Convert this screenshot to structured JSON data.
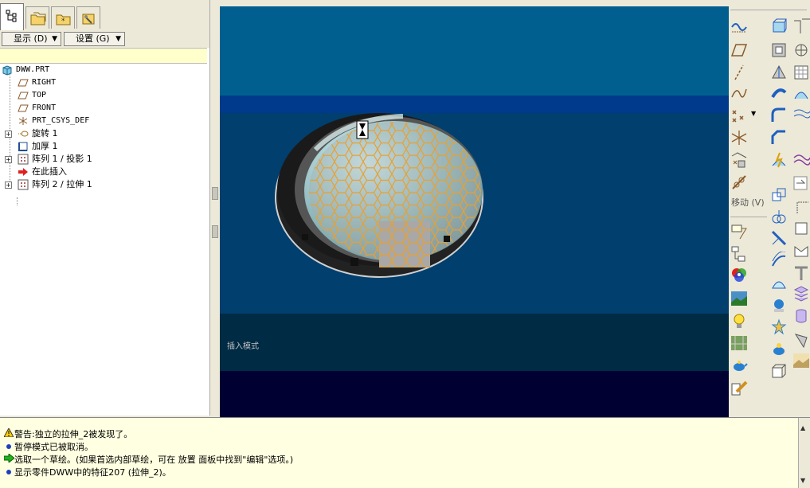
{
  "toolbar": {
    "display_label": "显示 (D)",
    "settings_label": "设置 (G)"
  },
  "tree": [
    {
      "label": "DWW.PRT",
      "icon": "part-icon",
      "expand": ""
    },
    {
      "label": "RIGHT",
      "icon": "datum-plane-icon",
      "expand": ""
    },
    {
      "label": "TOP",
      "icon": "datum-plane-icon",
      "expand": ""
    },
    {
      "label": "FRONT",
      "icon": "datum-plane-icon",
      "expand": ""
    },
    {
      "label": "PRT_CSYS_DEF",
      "icon": "coordinate-system-icon",
      "expand": ""
    },
    {
      "label": "旋转 1",
      "icon": "revolve-icon",
      "expand": "+"
    },
    {
      "label": "加厚 1",
      "icon": "thicken-icon",
      "expand": ""
    },
    {
      "label": "阵列 1 / 投影 1",
      "icon": "pattern-icon",
      "expand": "+"
    },
    {
      "label": "在此插入",
      "icon": "insert-here-arrow-icon",
      "expand": ""
    },
    {
      "label": "阵列 2 / 拉伸 1",
      "icon": "pattern-icon",
      "expand": "+"
    }
  ],
  "viewport": {
    "status_text": "插入模式"
  },
  "right_toolbar": {
    "move_label": "移动 (V)"
  },
  "messages": [
    {
      "icon": "warning-icon",
      "text": "警告:独立的拉伸_2被发现了。"
    },
    {
      "icon": "info-bullet-icon",
      "text": "暂停模式已被取消。"
    },
    {
      "icon": "prompt-arrow-icon",
      "text": "选取一个草绘。(如果首选内部草绘，可在 放置 面板中找到\"编辑\"选项。)"
    },
    {
      "icon": "info-bullet-icon",
      "text": "显示零件DWW中的特征207 (拉伸_2)。"
    }
  ],
  "colors": {
    "viewport_top": "#005f8f",
    "viewport_band": "#003a8c",
    "viewport_mid": "#003f6e",
    "viewport_dark": "#002b44",
    "viewport_bottom": "#000033",
    "honeycomb": "#e8a030",
    "message_bg": "#ffffe1"
  }
}
